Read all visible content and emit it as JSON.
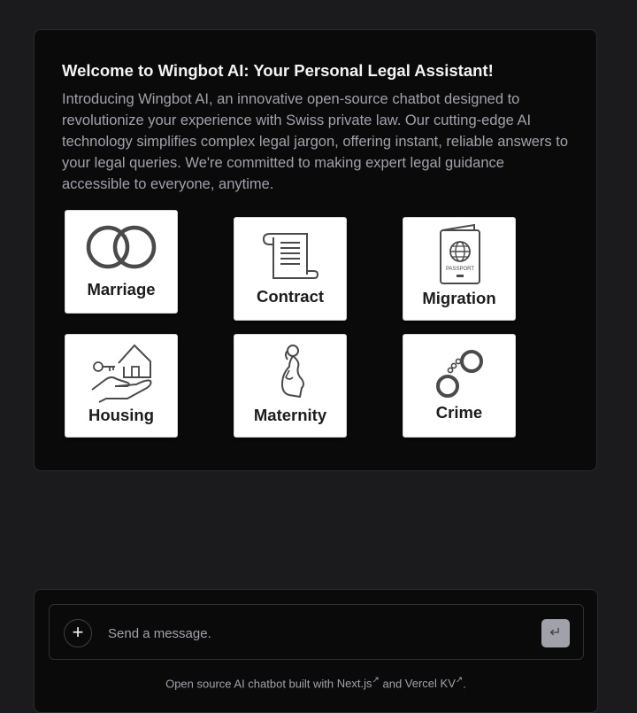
{
  "welcome": {
    "title": "Welcome to Wingbot AI: Your Personal Legal Assistant!",
    "description": "Introducing Wingbot AI, an innovative open-source chatbot designed to revolutionize your experience with Swiss private law. Our cutting-edge AI technology simplifies complex legal jargon, offering instant, reliable answers to your legal queries. We're committed to making expert legal guidance accessible to everyone, anytime."
  },
  "topics": [
    {
      "label": "Marriage",
      "icon": "wedding-rings-icon"
    },
    {
      "label": "Contract",
      "icon": "scroll-icon"
    },
    {
      "label": "Migration",
      "icon": "passport-icon"
    },
    {
      "label": "Housing",
      "icon": "house-key-hand-icon"
    },
    {
      "label": "Maternity",
      "icon": "pregnant-woman-icon"
    },
    {
      "label": "Crime",
      "icon": "handcuffs-icon"
    }
  ],
  "passport_text": "PASSPORT",
  "composer": {
    "new_chat_symbol": "+",
    "placeholder": "Send a message.",
    "send_symbol": "↵"
  },
  "footer": {
    "prefix": "Open source AI chatbot built with ",
    "link1": "Next.js",
    "middle": " and ",
    "link2": "Vercel KV",
    "suffix": ".",
    "ext_symbol": "↗"
  }
}
